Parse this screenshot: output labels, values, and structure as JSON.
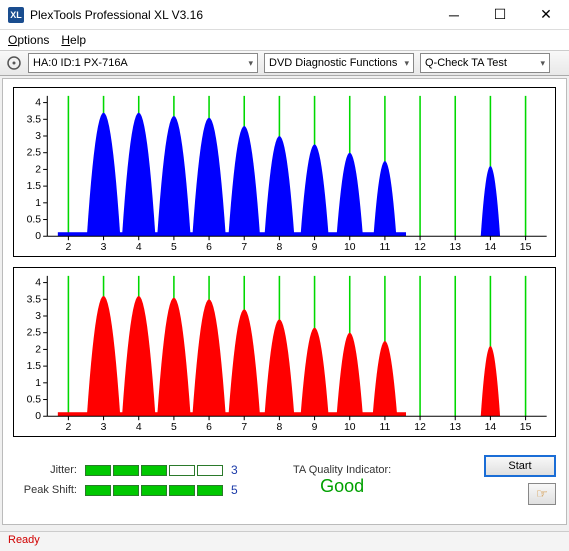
{
  "window": {
    "title": "PlexTools Professional XL V3.16",
    "icon_label": "XL"
  },
  "menu": {
    "options": "Options",
    "help": "Help"
  },
  "toolbar": {
    "drive": "HA:0 ID:1   PX-716A",
    "functions": "DVD Diagnostic Functions",
    "test": "Q-Check TA Test"
  },
  "chart_data": [
    {
      "type": "bar",
      "title": "",
      "xlabel": "",
      "ylabel": "",
      "x_ticks": [
        2,
        3,
        4,
        5,
        6,
        7,
        8,
        9,
        10,
        11,
        12,
        13,
        14,
        15
      ],
      "y_ticks": [
        0,
        0.5,
        1,
        1.5,
        2,
        2.5,
        3,
        3.5,
        4
      ],
      "ylim": [
        0,
        4.2
      ],
      "xlim": [
        1.4,
        15.6
      ],
      "vlines": [
        2,
        3,
        4,
        5,
        6,
        7,
        8,
        9,
        10,
        11,
        12,
        13,
        14,
        15
      ],
      "color": "#0000ff",
      "series": [
        {
          "center": 3,
          "peak": 3.7,
          "width": 0.95
        },
        {
          "center": 4,
          "peak": 3.7,
          "width": 0.95
        },
        {
          "center": 5,
          "peak": 3.6,
          "width": 0.95
        },
        {
          "center": 6,
          "peak": 3.55,
          "width": 0.95
        },
        {
          "center": 7,
          "peak": 3.3,
          "width": 0.9
        },
        {
          "center": 8,
          "peak": 3.0,
          "width": 0.85
        },
        {
          "center": 9,
          "peak": 2.75,
          "width": 0.8
        },
        {
          "center": 10,
          "peak": 2.5,
          "width": 0.75
        },
        {
          "center": 11,
          "peak": 2.25,
          "width": 0.65
        },
        {
          "center": 14,
          "peak": 2.1,
          "width": 0.55
        }
      ]
    },
    {
      "type": "bar",
      "title": "",
      "xlabel": "",
      "ylabel": "",
      "x_ticks": [
        2,
        3,
        4,
        5,
        6,
        7,
        8,
        9,
        10,
        11,
        12,
        13,
        14,
        15
      ],
      "y_ticks": [
        0,
        0.5,
        1,
        1.5,
        2,
        2.5,
        3,
        3.5,
        4
      ],
      "ylim": [
        0,
        4.2
      ],
      "xlim": [
        1.4,
        15.6
      ],
      "vlines": [
        2,
        3,
        4,
        5,
        6,
        7,
        8,
        9,
        10,
        11,
        12,
        13,
        14,
        15
      ],
      "color": "#ff0000",
      "series": [
        {
          "center": 3,
          "peak": 3.6,
          "width": 0.95
        },
        {
          "center": 4,
          "peak": 3.6,
          "width": 0.95
        },
        {
          "center": 5,
          "peak": 3.55,
          "width": 0.95
        },
        {
          "center": 6,
          "peak": 3.5,
          "width": 0.95
        },
        {
          "center": 7,
          "peak": 3.2,
          "width": 0.9
        },
        {
          "center": 8,
          "peak": 2.9,
          "width": 0.85
        },
        {
          "center": 9,
          "peak": 2.65,
          "width": 0.8
        },
        {
          "center": 10,
          "peak": 2.5,
          "width": 0.75
        },
        {
          "center": 11,
          "peak": 2.25,
          "width": 0.7
        },
        {
          "center": 14,
          "peak": 2.1,
          "width": 0.55
        }
      ]
    }
  ],
  "stats": {
    "jitter": {
      "label": "Jitter:",
      "value": "3",
      "filled": 3,
      "total": 5
    },
    "peakshift": {
      "label": "Peak Shift:",
      "value": "5",
      "filled": 5,
      "total": 5
    }
  },
  "quality": {
    "label": "TA Quality Indicator:",
    "value": "Good"
  },
  "buttons": {
    "start": "Start"
  },
  "status": "Ready"
}
